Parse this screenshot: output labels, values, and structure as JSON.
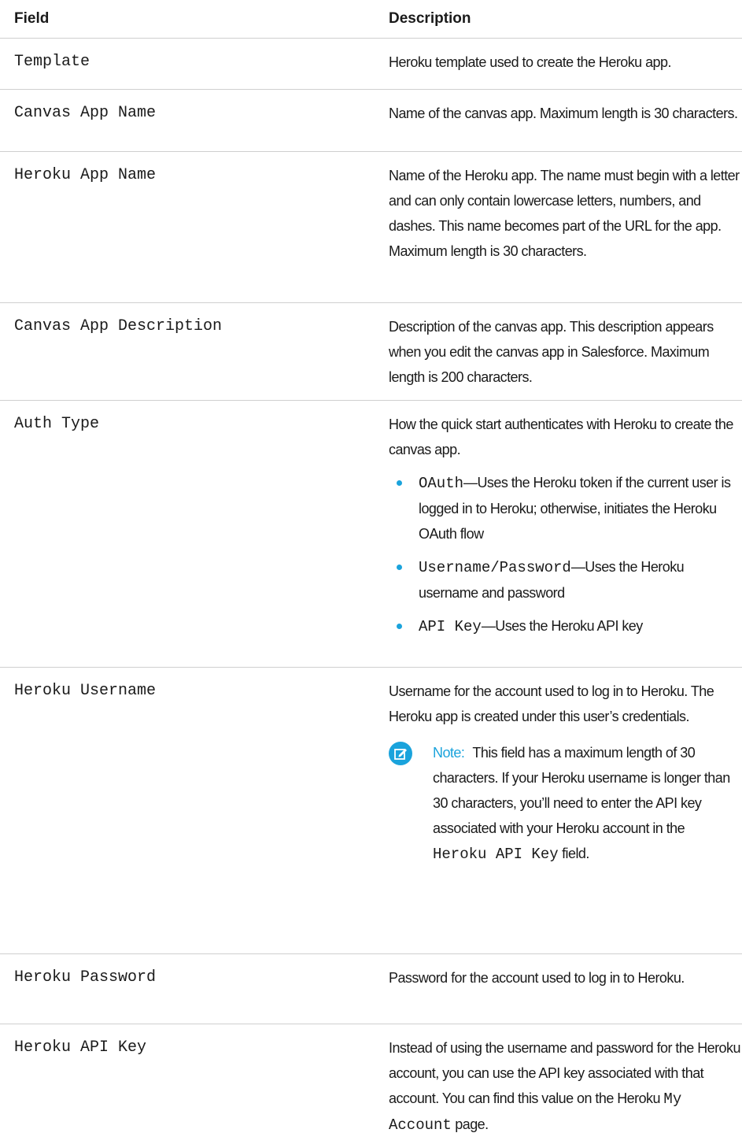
{
  "table": {
    "headers": {
      "field": "Field",
      "description": "Description"
    },
    "rows": [
      {
        "field": "Template",
        "description": "Heroku template used to create the Heroku app."
      },
      {
        "field": "Canvas App Name",
        "description": "Name of the canvas app. Maximum length is 30 characters."
      },
      {
        "field": "Heroku App Name",
        "description": "Name of the Heroku app. The name must begin with a letter and can only contain lowercase letters, numbers, and dashes. This name becomes part of the URL for the app. Maximum length is 30 characters."
      },
      {
        "field": "Canvas App Description",
        "description": "Description of the canvas app. This description appears when you edit the canvas app in Salesforce. Maximum length is 200 characters."
      },
      {
        "field": "Auth Type",
        "description": "How the quick start authenticates with Heroku to create the canvas app.",
        "options": [
          {
            "code": "OAuth",
            "text": "—Uses the Heroku token if the current user is logged in to Heroku; otherwise, initiates the Heroku OAuth flow"
          },
          {
            "code": "Username/Password",
            "text": "—Uses the Heroku username and password"
          },
          {
            "code": "API Key",
            "text": "—Uses the Heroku API key"
          }
        ]
      },
      {
        "field": "Heroku Username",
        "description": "Username for the account used to log in to Heroku. The Heroku app is created under this user’s credentials.",
        "note": {
          "label": "Note:",
          "text_before": "This field has a maximum length of 30 characters. If your Heroku username is longer than 30 characters, you’ll need to enter the API key associated with your Heroku account in the",
          "code": "Heroku API Key",
          "text_after": "field."
        }
      },
      {
        "field": "Heroku Password",
        "description": "Password for the account used to log in to Heroku."
      },
      {
        "field": "Heroku API Key",
        "description_before": "Instead of using the username and password for the Heroku account, you can use the API key associated with that account. You can find this value on the Heroku",
        "code": "My Account",
        "description_after": "page."
      }
    ]
  },
  "colors": {
    "accent": "#1aa3dc",
    "text": "#1a1a1a",
    "divider": "#cfcfcf"
  },
  "icons": {
    "note": "note-edit-icon"
  }
}
